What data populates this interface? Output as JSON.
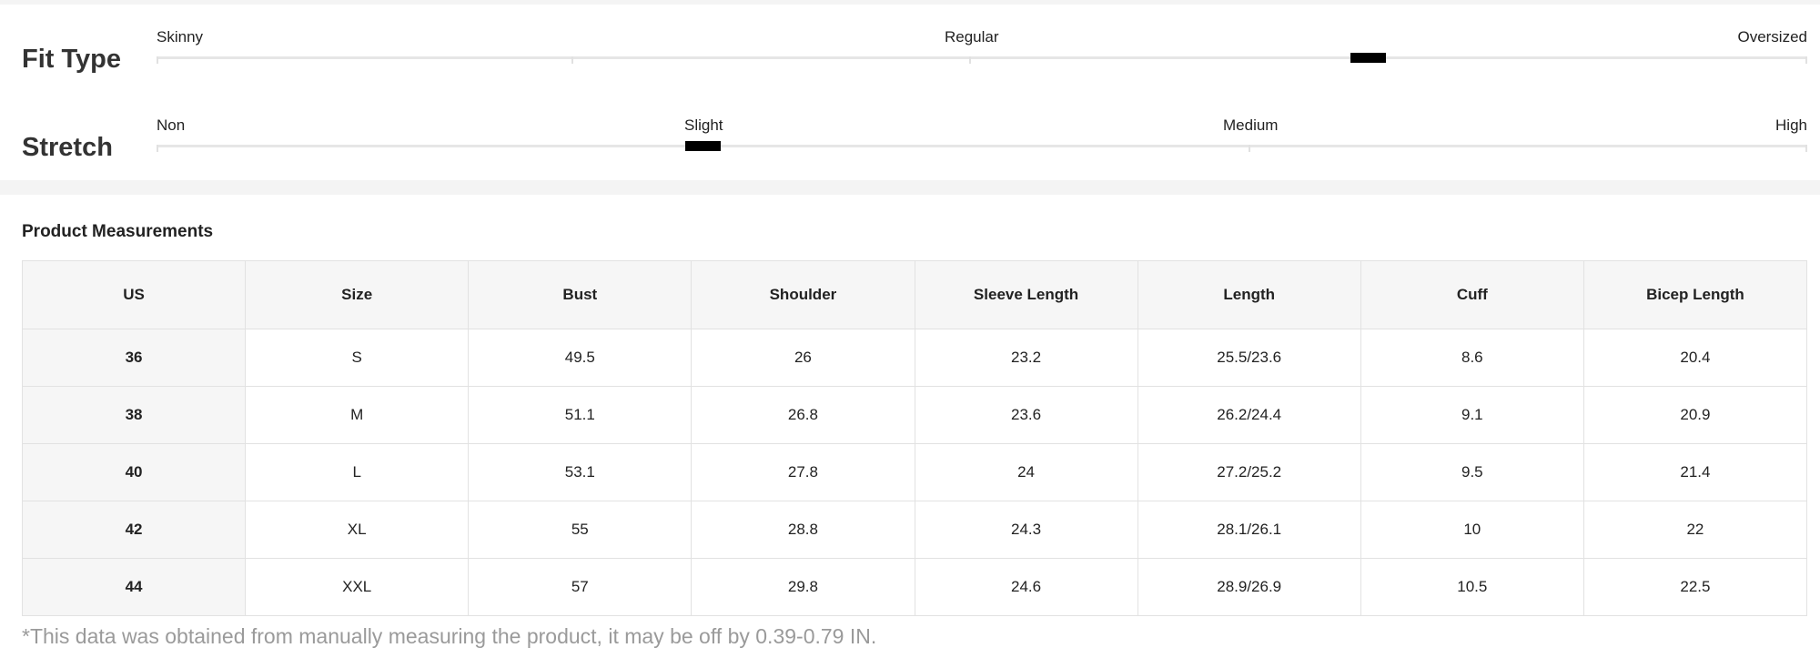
{
  "fit_type": {
    "title": "Fit Type",
    "labels": [
      "Skinny",
      "Regular",
      "Oversized"
    ],
    "level": 0.75
  },
  "stretch": {
    "title": "Stretch",
    "labels": [
      "Non",
      "Slight",
      "Medium",
      "High"
    ],
    "level": 0.333
  },
  "measurements": {
    "title": "Product Measurements",
    "columns": [
      "US",
      "Size",
      "Bust",
      "Shoulder",
      "Sleeve Length",
      "Length",
      "Cuff",
      "Bicep Length"
    ],
    "rows": [
      [
        "36",
        "S",
        "49.5",
        "26",
        "23.2",
        "25.5/23.6",
        "8.6",
        "20.4"
      ],
      [
        "38",
        "M",
        "51.1",
        "26.8",
        "23.6",
        "26.2/24.4",
        "9.1",
        "20.9"
      ],
      [
        "40",
        "L",
        "53.1",
        "27.8",
        "24",
        "27.2/25.2",
        "9.5",
        "21.4"
      ],
      [
        "42",
        "XL",
        "55",
        "28.8",
        "24.3",
        "28.1/26.1",
        "10",
        "22"
      ],
      [
        "44",
        "XXL",
        "57",
        "29.8",
        "24.6",
        "28.9/26.9",
        "10.5",
        "22.5"
      ]
    ]
  },
  "footnote": "*This data was obtained from manually measuring the product, it may be off by 0.39-0.79 IN."
}
